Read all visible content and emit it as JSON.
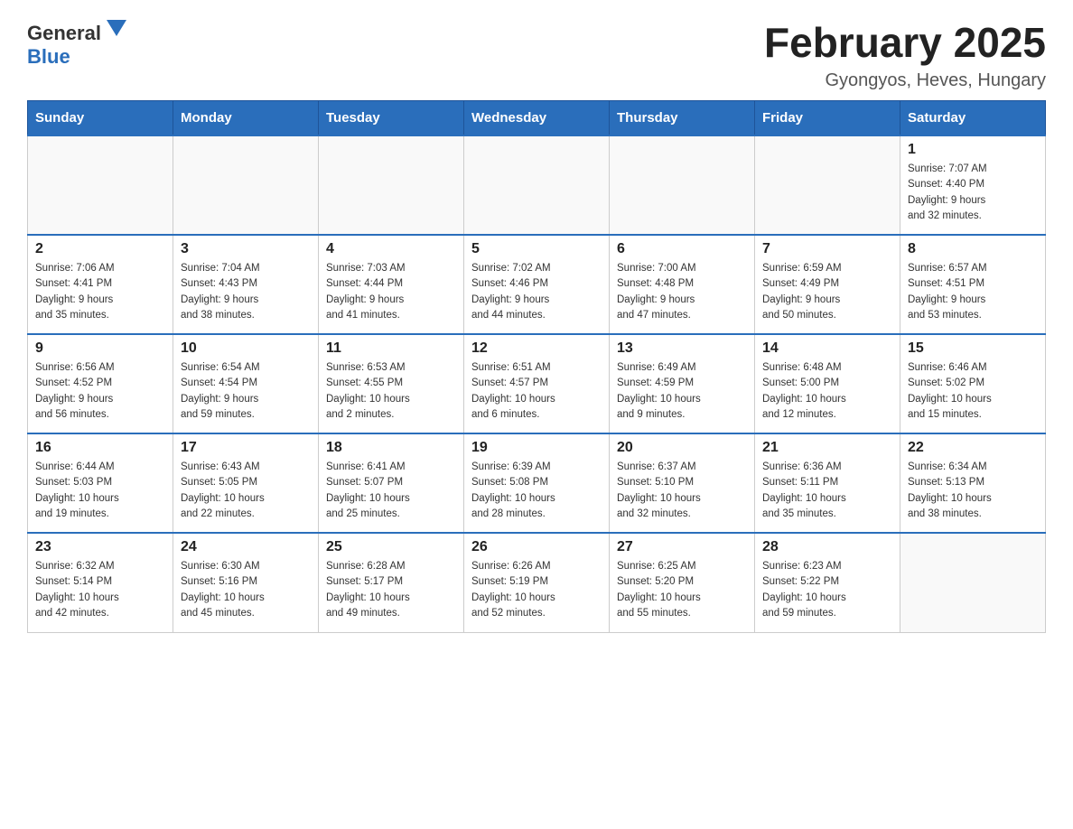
{
  "header": {
    "logo_general": "General",
    "logo_blue": "Blue",
    "title": "February 2025",
    "subtitle": "Gyongyos, Heves, Hungary"
  },
  "days_of_week": [
    "Sunday",
    "Monday",
    "Tuesday",
    "Wednesday",
    "Thursday",
    "Friday",
    "Saturday"
  ],
  "weeks": [
    [
      {
        "day": "",
        "info": ""
      },
      {
        "day": "",
        "info": ""
      },
      {
        "day": "",
        "info": ""
      },
      {
        "day": "",
        "info": ""
      },
      {
        "day": "",
        "info": ""
      },
      {
        "day": "",
        "info": ""
      },
      {
        "day": "1",
        "info": "Sunrise: 7:07 AM\nSunset: 4:40 PM\nDaylight: 9 hours\nand 32 minutes."
      }
    ],
    [
      {
        "day": "2",
        "info": "Sunrise: 7:06 AM\nSunset: 4:41 PM\nDaylight: 9 hours\nand 35 minutes."
      },
      {
        "day": "3",
        "info": "Sunrise: 7:04 AM\nSunset: 4:43 PM\nDaylight: 9 hours\nand 38 minutes."
      },
      {
        "day": "4",
        "info": "Sunrise: 7:03 AM\nSunset: 4:44 PM\nDaylight: 9 hours\nand 41 minutes."
      },
      {
        "day": "5",
        "info": "Sunrise: 7:02 AM\nSunset: 4:46 PM\nDaylight: 9 hours\nand 44 minutes."
      },
      {
        "day": "6",
        "info": "Sunrise: 7:00 AM\nSunset: 4:48 PM\nDaylight: 9 hours\nand 47 minutes."
      },
      {
        "day": "7",
        "info": "Sunrise: 6:59 AM\nSunset: 4:49 PM\nDaylight: 9 hours\nand 50 minutes."
      },
      {
        "day": "8",
        "info": "Sunrise: 6:57 AM\nSunset: 4:51 PM\nDaylight: 9 hours\nand 53 minutes."
      }
    ],
    [
      {
        "day": "9",
        "info": "Sunrise: 6:56 AM\nSunset: 4:52 PM\nDaylight: 9 hours\nand 56 minutes."
      },
      {
        "day": "10",
        "info": "Sunrise: 6:54 AM\nSunset: 4:54 PM\nDaylight: 9 hours\nand 59 minutes."
      },
      {
        "day": "11",
        "info": "Sunrise: 6:53 AM\nSunset: 4:55 PM\nDaylight: 10 hours\nand 2 minutes."
      },
      {
        "day": "12",
        "info": "Sunrise: 6:51 AM\nSunset: 4:57 PM\nDaylight: 10 hours\nand 6 minutes."
      },
      {
        "day": "13",
        "info": "Sunrise: 6:49 AM\nSunset: 4:59 PM\nDaylight: 10 hours\nand 9 minutes."
      },
      {
        "day": "14",
        "info": "Sunrise: 6:48 AM\nSunset: 5:00 PM\nDaylight: 10 hours\nand 12 minutes."
      },
      {
        "day": "15",
        "info": "Sunrise: 6:46 AM\nSunset: 5:02 PM\nDaylight: 10 hours\nand 15 minutes."
      }
    ],
    [
      {
        "day": "16",
        "info": "Sunrise: 6:44 AM\nSunset: 5:03 PM\nDaylight: 10 hours\nand 19 minutes."
      },
      {
        "day": "17",
        "info": "Sunrise: 6:43 AM\nSunset: 5:05 PM\nDaylight: 10 hours\nand 22 minutes."
      },
      {
        "day": "18",
        "info": "Sunrise: 6:41 AM\nSunset: 5:07 PM\nDaylight: 10 hours\nand 25 minutes."
      },
      {
        "day": "19",
        "info": "Sunrise: 6:39 AM\nSunset: 5:08 PM\nDaylight: 10 hours\nand 28 minutes."
      },
      {
        "day": "20",
        "info": "Sunrise: 6:37 AM\nSunset: 5:10 PM\nDaylight: 10 hours\nand 32 minutes."
      },
      {
        "day": "21",
        "info": "Sunrise: 6:36 AM\nSunset: 5:11 PM\nDaylight: 10 hours\nand 35 minutes."
      },
      {
        "day": "22",
        "info": "Sunrise: 6:34 AM\nSunset: 5:13 PM\nDaylight: 10 hours\nand 38 minutes."
      }
    ],
    [
      {
        "day": "23",
        "info": "Sunrise: 6:32 AM\nSunset: 5:14 PM\nDaylight: 10 hours\nand 42 minutes."
      },
      {
        "day": "24",
        "info": "Sunrise: 6:30 AM\nSunset: 5:16 PM\nDaylight: 10 hours\nand 45 minutes."
      },
      {
        "day": "25",
        "info": "Sunrise: 6:28 AM\nSunset: 5:17 PM\nDaylight: 10 hours\nand 49 minutes."
      },
      {
        "day": "26",
        "info": "Sunrise: 6:26 AM\nSunset: 5:19 PM\nDaylight: 10 hours\nand 52 minutes."
      },
      {
        "day": "27",
        "info": "Sunrise: 6:25 AM\nSunset: 5:20 PM\nDaylight: 10 hours\nand 55 minutes."
      },
      {
        "day": "28",
        "info": "Sunrise: 6:23 AM\nSunset: 5:22 PM\nDaylight: 10 hours\nand 59 minutes."
      },
      {
        "day": "",
        "info": ""
      }
    ]
  ]
}
